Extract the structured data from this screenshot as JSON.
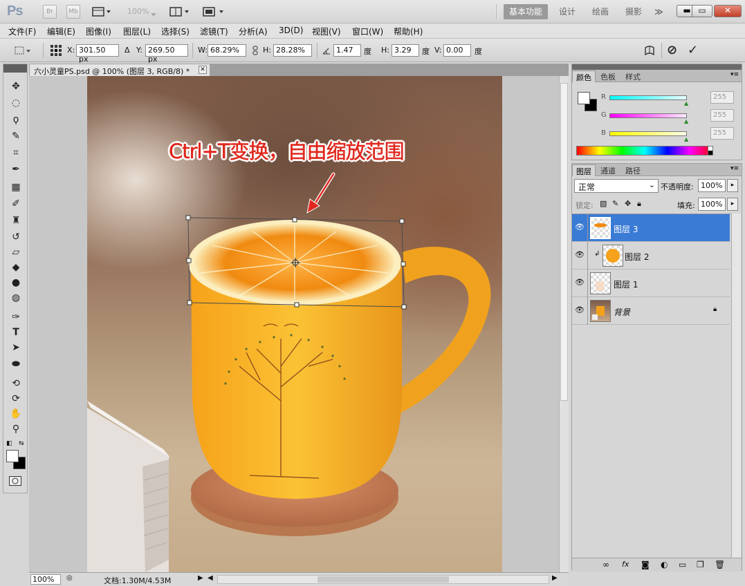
{
  "app": {
    "logo": "Ps",
    "toolbar_badges": [
      "Br",
      "Mb"
    ],
    "zoom": "100%",
    "workspaces": [
      "基本功能",
      "设计",
      "绘画",
      "摄影"
    ],
    "workspace_more": "≫",
    "window_buttons": {
      "minimize": "▬",
      "restore": "▭",
      "close": "✕"
    }
  },
  "menu": [
    "文件(F)",
    "编辑(E)",
    "图像(I)",
    "图层(L)",
    "选择(S)",
    "滤镜(T)",
    "分析(A)",
    "3D(D)",
    "视图(V)",
    "窗口(W)",
    "帮助(H)"
  ],
  "options": {
    "x_label": "X:",
    "x_value": "301.50 px",
    "y_label": "Y:",
    "y_value": "269.50 px",
    "w_label": "W:",
    "w_value": "68.29%",
    "h_label": "H:",
    "h_value": "28.28%",
    "angle_value": "1.47",
    "angle_unit": "度",
    "hskew_label": "H:",
    "hskew_value": "3.29",
    "hskew_unit": "度",
    "vskew_label": "V:",
    "vskew_value": "0.00",
    "vskew_unit": "度",
    "cancel_symbol": "⊘",
    "commit_symbol": "✓"
  },
  "document": {
    "tab_title": "六小灵童PS.psd @ 100% (图层 3, RGB/8) *",
    "annotation": "Ctrl+T变换，自由缩放范围",
    "status_zoom": "100%",
    "status_doc": "文档:1.30M/4.53M"
  },
  "color_panel": {
    "tabs": [
      "颜色",
      "色板",
      "样式"
    ],
    "channels": [
      {
        "label": "R",
        "value": "255",
        "color": "#00d8d8"
      },
      {
        "label": "G",
        "value": "255",
        "color": "#e000e0"
      },
      {
        "label": "B",
        "value": "255",
        "color": "#e8e800"
      }
    ]
  },
  "layers_panel": {
    "tabs": [
      "图层",
      "通道",
      "路径"
    ],
    "blend_mode": "正常",
    "opacity_label": "不透明度:",
    "opacity_value": "100%",
    "lock_label": "锁定:",
    "fill_label": "填充:",
    "fill_value": "100%",
    "layers": [
      {
        "name": "图层 3",
        "selected": true
      },
      {
        "name": "图层 2",
        "selected": false
      },
      {
        "name": "图层 1",
        "selected": false
      },
      {
        "name": "背景",
        "selected": false
      }
    ]
  },
  "colors": {
    "accent": "#3a7bd5",
    "annotation_red": "#e0281e",
    "orange": "#f2a21a"
  }
}
